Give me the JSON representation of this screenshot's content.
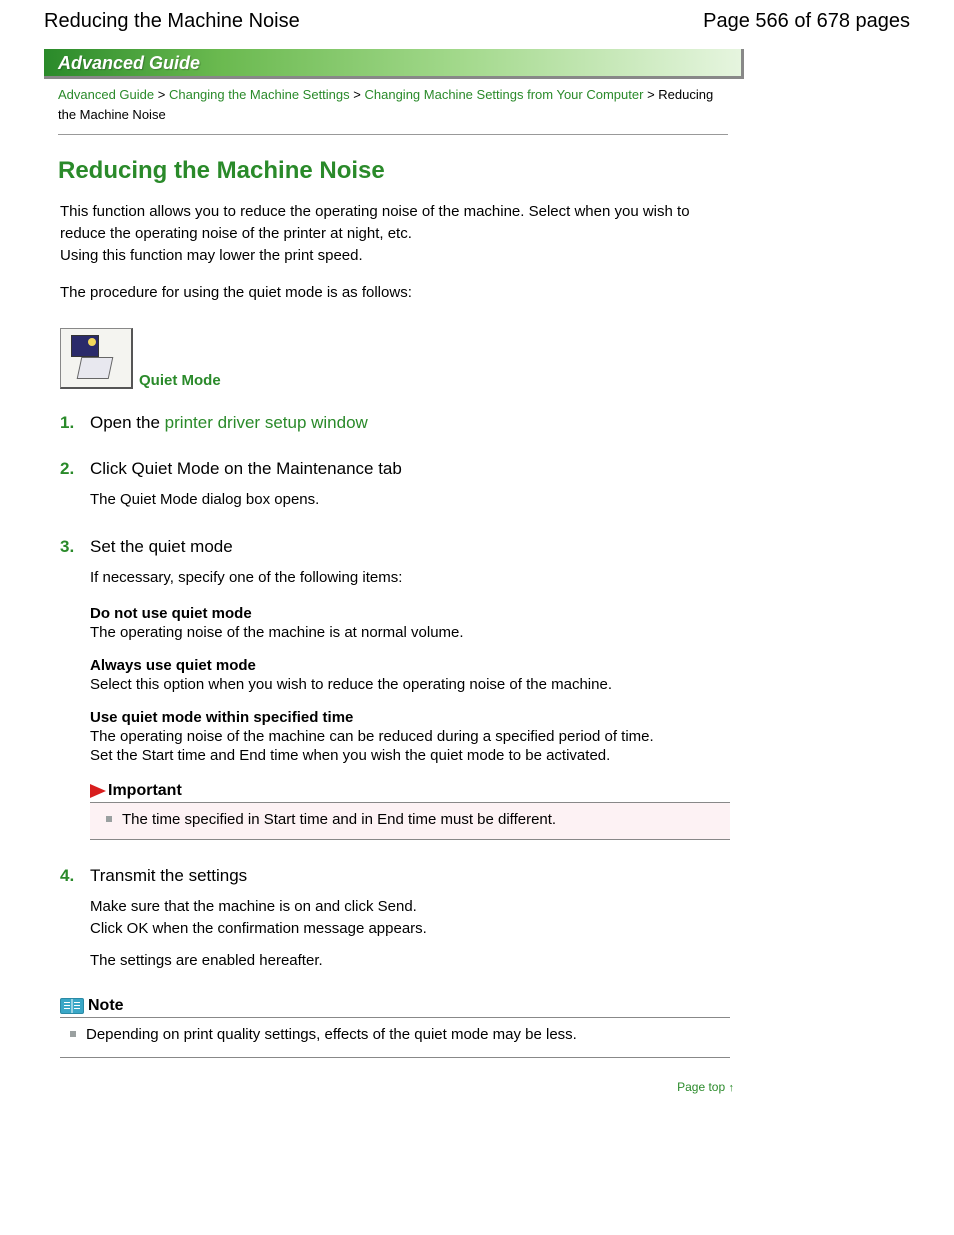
{
  "header": {
    "doc_title": "Reducing the Machine Noise",
    "page_indicator": "Page 566 of 678 pages"
  },
  "banner": {
    "label": "Advanced Guide"
  },
  "breadcrumb": {
    "items": [
      "Advanced Guide",
      "Changing the Machine Settings",
      "Changing Machine Settings from Your Computer"
    ],
    "current": "Reducing the Machine Noise",
    "sep": " > "
  },
  "title": "Reducing the Machine Noise",
  "intro": {
    "p1a": "This function allows you to reduce the operating noise of the machine. Select when you wish to reduce the operating noise of the printer at night, etc.",
    "p1b": "Using this function may lower the print speed.",
    "p2": "The procedure for using the quiet mode is as follows:"
  },
  "quiet_mode_label": "Quiet Mode",
  "steps": [
    {
      "title_pre": "Open the ",
      "title_link": "printer driver setup window"
    },
    {
      "title": "Click Quiet Mode on the Maintenance tab",
      "body1": "The Quiet Mode dialog box opens."
    },
    {
      "title": "Set the quiet mode",
      "body1": "If necessary, specify one of the following items:",
      "options": [
        {
          "name": "Do not use quiet mode",
          "desc": "The operating noise of the machine is at normal volume."
        },
        {
          "name": "Always use quiet mode",
          "desc": "Select this option when you wish to reduce the operating noise of the machine."
        },
        {
          "name": "Use quiet mode within specified time",
          "desc": "The operating noise of the machine can be reduced during a specified period of time.",
          "desc2": "Set the Start time and End time when you wish the quiet mode to be activated."
        }
      ],
      "important": {
        "heading": "Important",
        "items": [
          "The time specified in Start time and in End time must be different."
        ]
      }
    },
    {
      "title": "Transmit the settings",
      "body1": "Make sure that the machine is on and click Send.",
      "body2": "Click OK when the confirmation message appears.",
      "body3": "The settings are enabled hereafter."
    }
  ],
  "note": {
    "heading": "Note",
    "items": [
      "Depending on print quality settings, effects of the quiet mode may be less."
    ]
  },
  "page_top": "Page top"
}
